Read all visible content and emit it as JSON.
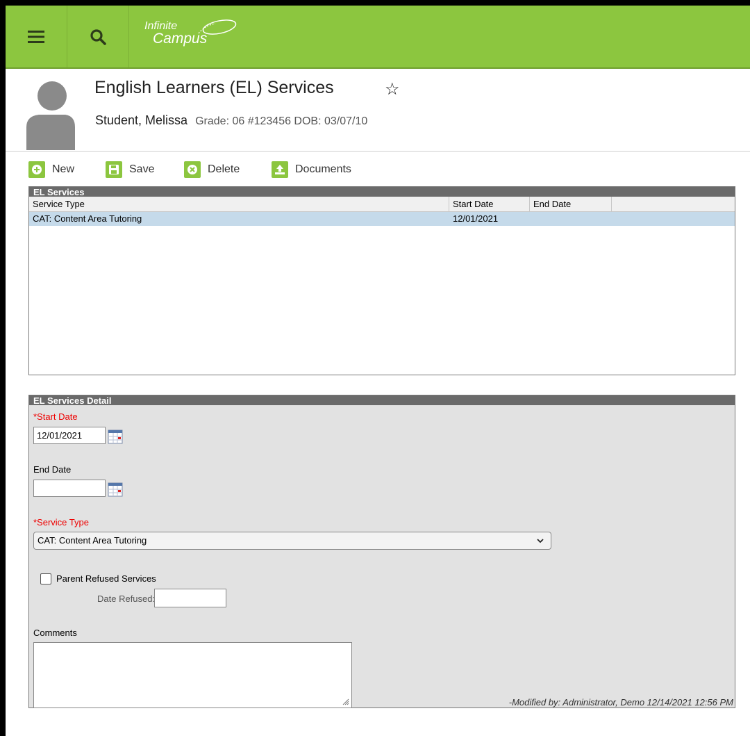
{
  "app": {
    "logo_line1": "Infinite",
    "logo_line2": "Campus"
  },
  "header": {
    "title": "English Learners (EL) Services",
    "student_name": "Student, Melissa",
    "student_meta": "Grade: 06 #123456 DOB: 03/07/10"
  },
  "toolbar": {
    "new_label": "New",
    "save_label": "Save",
    "delete_label": "Delete",
    "documents_label": "Documents"
  },
  "services": {
    "title": "EL Services",
    "columns": [
      "Service Type",
      "Start Date",
      "End Date"
    ],
    "rows": [
      {
        "service_type": "CAT: Content Area Tutoring",
        "start_date": "12/01/2021",
        "end_date": ""
      }
    ]
  },
  "detail": {
    "title": "EL Services Detail",
    "start_date_label": "*Start Date",
    "start_date_value": "12/01/2021",
    "end_date_label": "End Date",
    "end_date_value": "",
    "service_type_label": "*Service Type",
    "service_type_value": "CAT: Content Area Tutoring",
    "parent_refused_label": "Parent Refused Services",
    "parent_refused_checked": false,
    "date_refused_label": "Date Refused:",
    "date_refused_value": "",
    "comments_label": "Comments",
    "comments_value": "",
    "modified_text": "-Modified by: Administrator, Demo 12/14/2021 12:56 PM"
  },
  "colors": {
    "brand_green": "#8cc63f",
    "selected_row": "#c5daea",
    "required_label": "#e00000"
  }
}
